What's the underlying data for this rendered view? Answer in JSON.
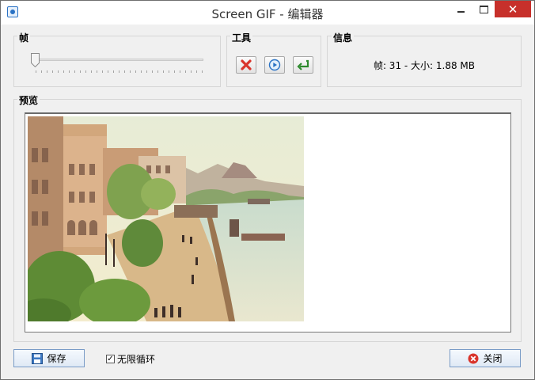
{
  "window": {
    "title": "Screen GIF - 编辑器"
  },
  "frames_group": {
    "label": "帧",
    "position": 0
  },
  "tools_group": {
    "label": "工具",
    "delete_icon": "red-x-icon",
    "play_icon": "play-icon",
    "undo_icon": "undo-arrow-icon"
  },
  "info_group": {
    "label": "信息",
    "text": "帧: 31 - 大小: 1.88 MB"
  },
  "preview_group": {
    "label": "预览"
  },
  "footer": {
    "save_label": "保存",
    "loop_label": "无限循环",
    "loop_checked": true,
    "close_label": "关闭"
  },
  "colors": {
    "accent": "#2a72c4",
    "close_red": "#c7302b",
    "delete_red": "#d9342b",
    "undo_green": "#2d8a2d"
  }
}
